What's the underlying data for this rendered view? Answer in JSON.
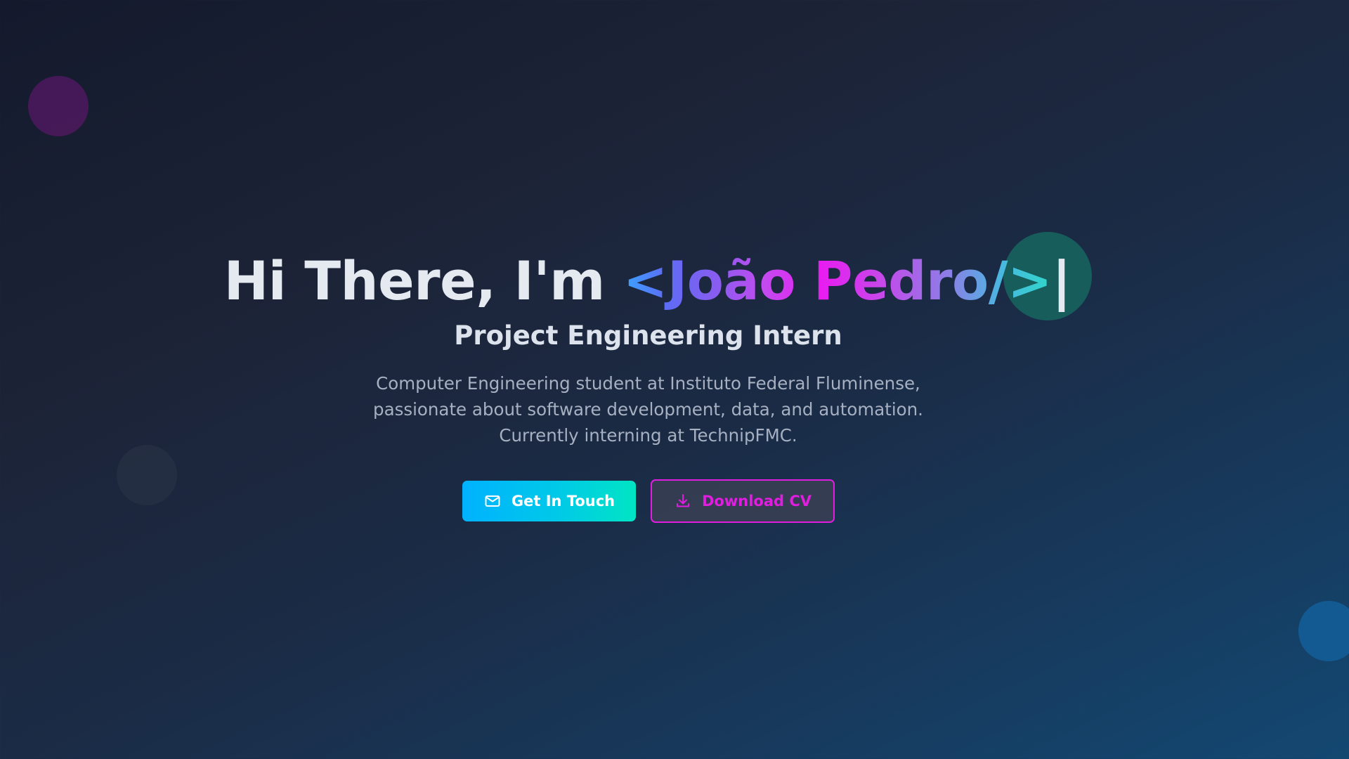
{
  "hero": {
    "greeting": "Hi There, I'm ",
    "name": "<João Pedro/>",
    "cursor": "|",
    "role": "Project Engineering Intern",
    "description_lines": [
      "Computer Engineering student at Instituto Federal Fluminense,",
      "passionate about software development, data, and automation.",
      "Currently interning at TechnipFMC."
    ]
  },
  "actions": {
    "contact": {
      "label": "Get In Touch",
      "icon": "mail-icon"
    },
    "cv": {
      "label": "Download CV",
      "icon": "download-icon"
    }
  },
  "colors": {
    "accent_magenta": "#e11ddf",
    "accent_cyan": "#00c9e8",
    "accent_blue": "#3aa3ff",
    "accent_teal": "#2fd7c9",
    "background_dark": "#141a2c",
    "background_blue": "#134872"
  }
}
